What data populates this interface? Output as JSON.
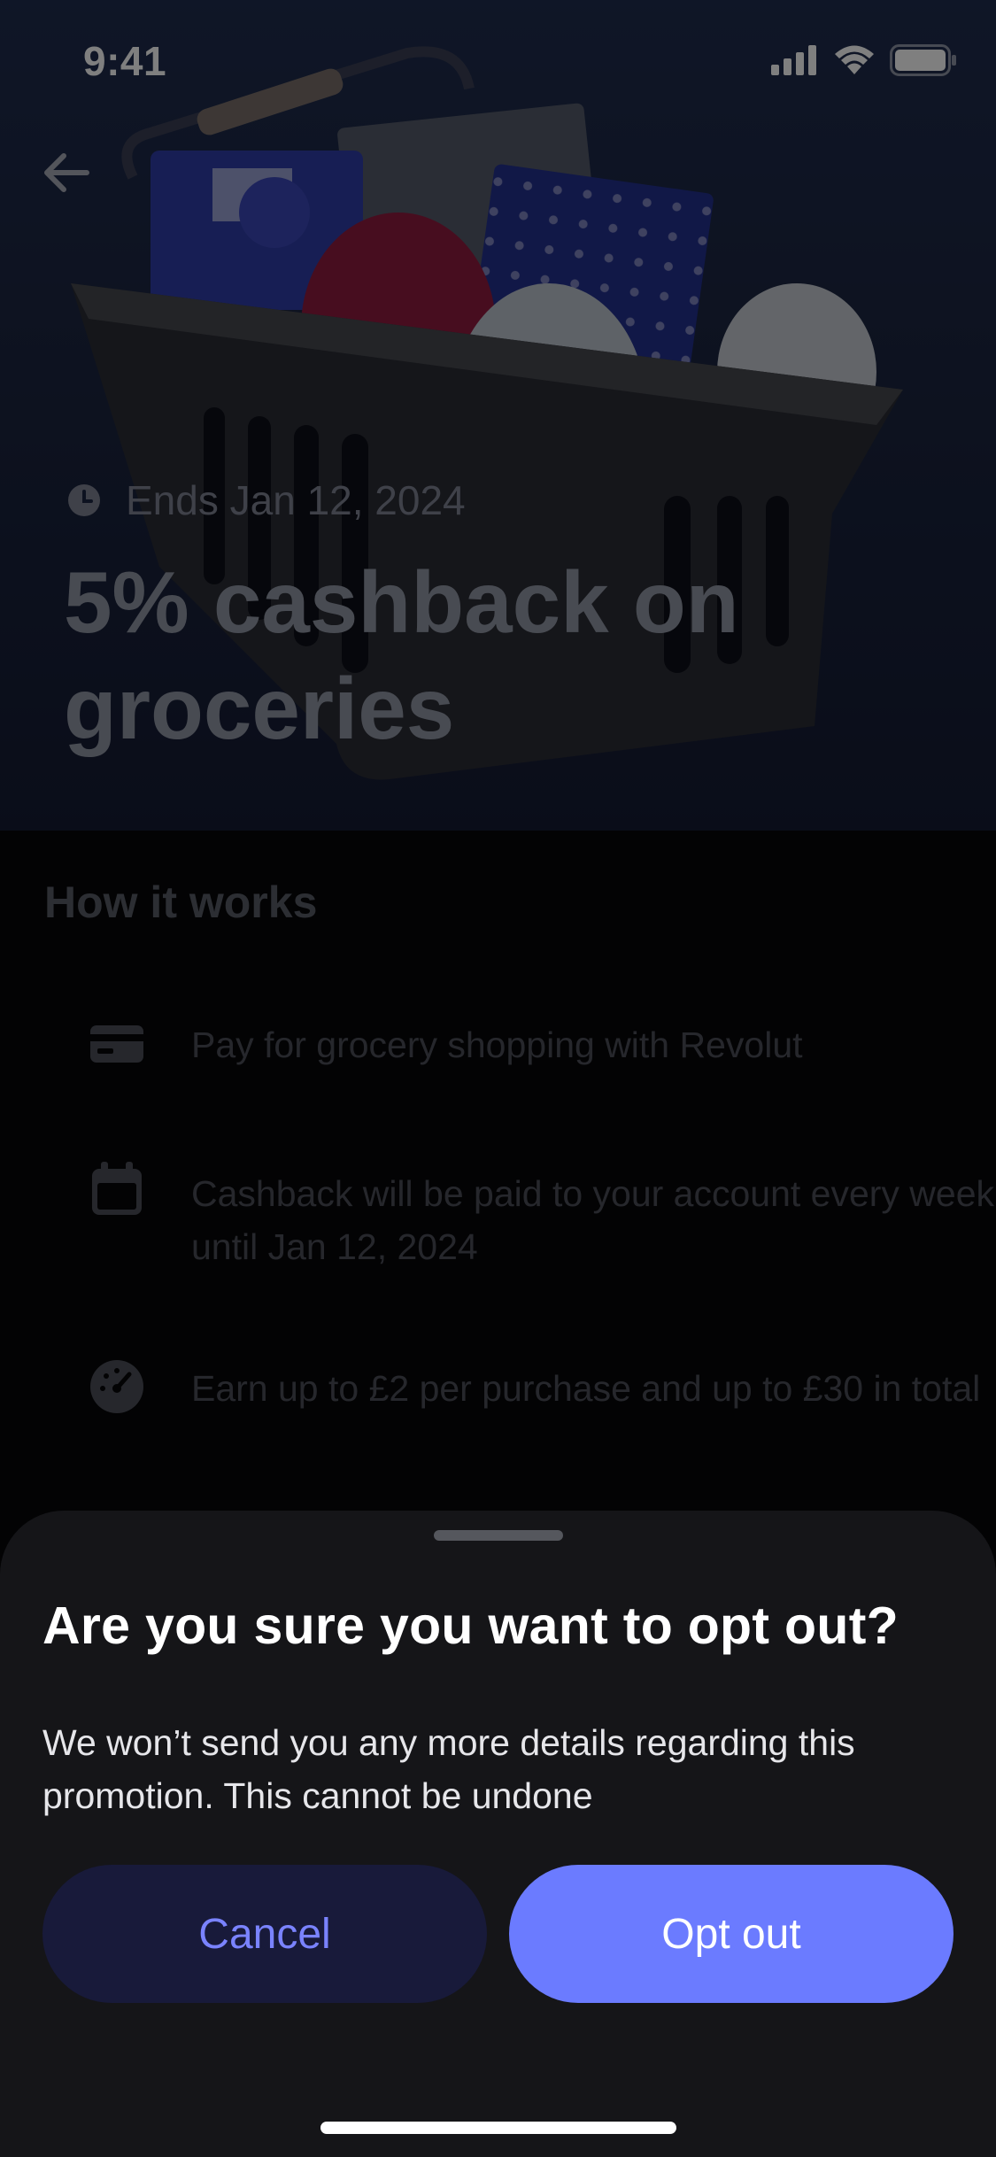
{
  "status_bar": {
    "time": "9:41"
  },
  "promo": {
    "ends_label": "Ends Jan 12, 2024",
    "title": "5% cashback on groceries"
  },
  "how_it_works": {
    "title": "How it works",
    "steps": [
      {
        "icon": "card-icon",
        "text": "Pay for grocery shopping with Revolut"
      },
      {
        "icon": "calendar-icon",
        "text": "Cashback will be paid to your account every week until Jan 12, 2024"
      },
      {
        "icon": "speedometer-icon",
        "text": "Earn up to £2 per purchase and up to £30 in total"
      }
    ]
  },
  "dialog": {
    "title": "Are you sure you want to opt out?",
    "message": "We won’t send you any more details regarding this promotion. This cannot be undone",
    "cancel_label": "Cancel",
    "confirm_label": "Opt out"
  },
  "colors": {
    "accent": "#6b7bff",
    "cancel_bg": "#181a3a",
    "sheet_bg": "#151518"
  }
}
